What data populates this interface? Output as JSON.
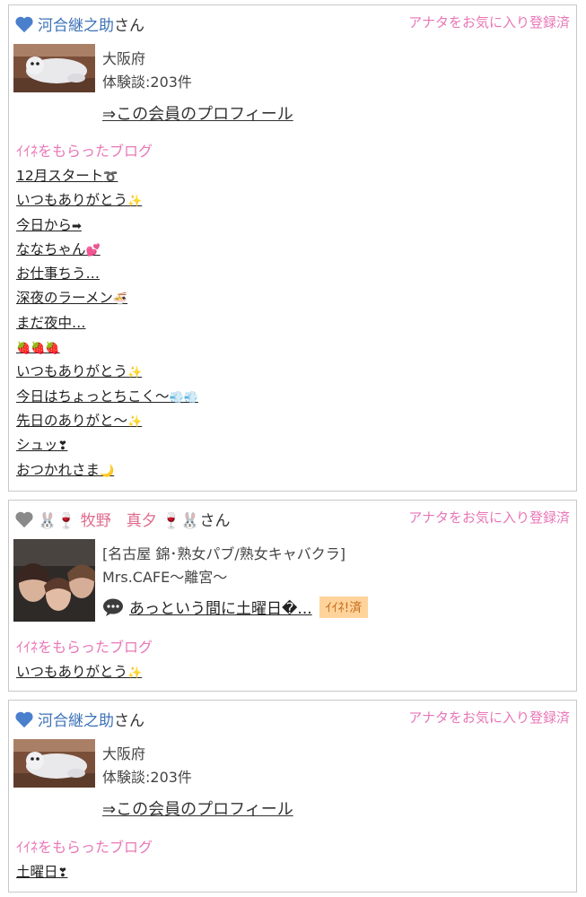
{
  "cards": [
    {
      "heart_color": "#4a7fcc",
      "member_name": "河合継之助",
      "san": "さん",
      "fav_status": "アナタをお気に入り登録済",
      "location": "大阪府",
      "experiences": "体験談:203件",
      "profile_link": "⇒この会員のプロフィール",
      "section_title": "ｲｲﾈをもらったブログ",
      "blogs": [
        {
          "text": "12月スタート",
          "emoji": "➰"
        },
        {
          "text": "いつもありがとう",
          "emoji": "✨"
        },
        {
          "text": "今日から",
          "emoji": "➡"
        },
        {
          "text": "ななちゃん",
          "emoji": "💕"
        },
        {
          "text": "お仕事ちう…",
          "emoji": ""
        },
        {
          "text": "深夜のラーメン",
          "emoji": "🍜"
        },
        {
          "text": "まだ夜中…",
          "emoji": ""
        },
        {
          "text": "",
          "emoji": "🍓🍓🍓"
        },
        {
          "text": "いつもありがとう",
          "emoji": "✨"
        },
        {
          "text": "今日はちょっとちこく～",
          "emoji": "💨💨"
        },
        {
          "text": "先日のありがと～",
          "emoji": "✨"
        },
        {
          "text": "シュッ",
          "emoji": "❣"
        },
        {
          "text": "おつかれさま",
          "emoji": "🌙"
        }
      ]
    },
    {
      "heart_color": "#8a8a8a",
      "member_name": "🐰🍷 牧野　真夕 🍷🐰",
      "san": "さん",
      "fav_status": "アナタをお気に入り登録済",
      "shop_line": "[名古屋 錦･熟女パブ/熟女キャバクラ]",
      "shop_name": "Mrs.CAFE〜離宮〜",
      "comment": "あっという間に土曜日�...",
      "badge": "ｲｲﾈ!済",
      "section_title": "ｲｲﾈをもらったブログ",
      "blogs": [
        {
          "text": "いつもありがとう",
          "emoji": "✨"
        }
      ]
    },
    {
      "heart_color": "#4a7fcc",
      "member_name": "河合継之助",
      "san": "さん",
      "fav_status": "アナタをお気に入り登録済",
      "location": "大阪府",
      "experiences": "体験談:203件",
      "profile_link": "⇒この会員のプロフィール",
      "section_title": "ｲｲﾈをもらったブログ",
      "blogs": [
        {
          "text": "土曜日",
          "emoji": "❣"
        }
      ]
    }
  ]
}
